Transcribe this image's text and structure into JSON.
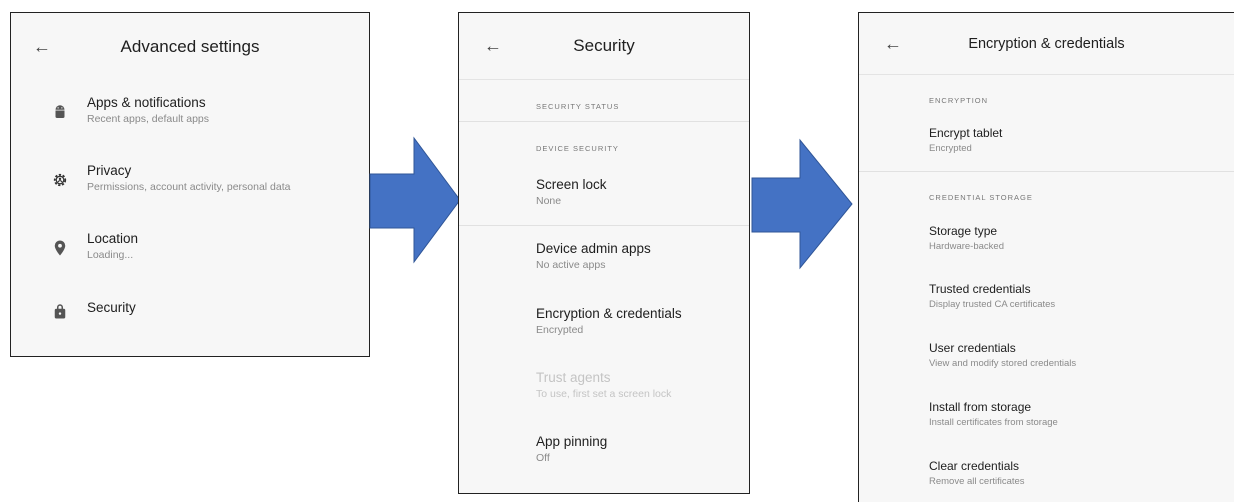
{
  "advanced": {
    "title": "Advanced settings",
    "items": [
      {
        "title": "Apps & notifications",
        "summary": "Recent apps, default apps",
        "icon": "android-icon"
      },
      {
        "title": "Privacy",
        "summary": "Permissions, account activity, personal data",
        "icon": "privacy-gear-icon"
      },
      {
        "title": "Location",
        "summary": "Loading...",
        "icon": "location-pin-icon"
      },
      {
        "title": "Security",
        "summary": "",
        "icon": "lock-icon"
      }
    ]
  },
  "security": {
    "title": "Security",
    "status_header": "SECURITY STATUS",
    "device_header": "DEVICE SECURITY",
    "items": [
      {
        "title": "Screen lock",
        "summary": "None"
      },
      {
        "title": "Device admin apps",
        "summary": "No active apps"
      },
      {
        "title": "Encryption & credentials",
        "summary": "Encrypted"
      },
      {
        "title": "Trust agents",
        "summary": "To use, first set a screen lock"
      },
      {
        "title": "App pinning",
        "summary": "Off"
      }
    ]
  },
  "encryption": {
    "title": "Encryption & credentials",
    "encryption_header": "ENCRYPTION",
    "credential_header": "CREDENTIAL STORAGE",
    "items": [
      {
        "title": "Encrypt tablet",
        "summary": "Encrypted"
      },
      {
        "title": "Storage type",
        "summary": "Hardware-backed"
      },
      {
        "title": "Trusted credentials",
        "summary": "Display trusted CA certificates"
      },
      {
        "title": "User credentials",
        "summary": "View and modify stored credentials"
      },
      {
        "title": "Install from storage",
        "summary": "Install certificates from storage"
      },
      {
        "title": "Clear credentials",
        "summary": "Remove all certificates"
      }
    ]
  },
  "back_icon": "←",
  "colors": {
    "arrow": "#4472C4",
    "panel_bg": "#f7f7f7"
  }
}
